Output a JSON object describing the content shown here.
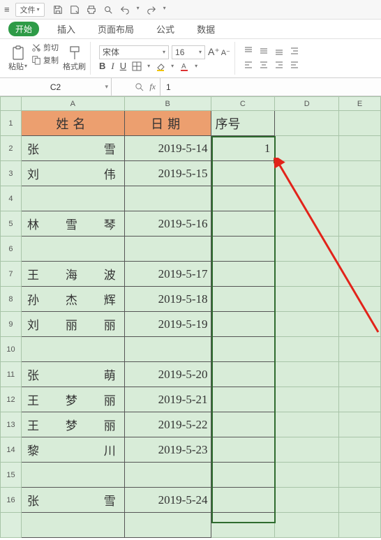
{
  "titlebar": {
    "file": "文件"
  },
  "tabs": {
    "start": "开始",
    "insert": "插入",
    "layout": "页面布局",
    "formula": "公式",
    "data": "数据"
  },
  "ribbon": {
    "paste": "粘贴",
    "cut": "剪切",
    "copy": "复制",
    "format_painter": "格式刷",
    "font_name": "宋体",
    "font_size": "16"
  },
  "namebox": "C2",
  "formula_value": "1",
  "columns": {
    "A": "A",
    "B": "B",
    "C": "C",
    "D": "D",
    "E": "E"
  },
  "header": {
    "name": "姓名",
    "date": "日期",
    "seq": "序号"
  },
  "seq_value": "1",
  "rows": {
    "2": {
      "name_chars": [
        "张",
        "",
        "雪"
      ],
      "date": "2019-5-14"
    },
    "3": {
      "name_chars": [
        "刘",
        "",
        "伟"
      ],
      "date": "2019-5-15"
    },
    "4": {
      "name_chars": [
        "",
        "",
        ""
      ],
      "date": ""
    },
    "5": {
      "name_chars": [
        "林",
        "雪",
        "琴"
      ],
      "date": "2019-5-16"
    },
    "6": {
      "name_chars": [
        "",
        "",
        ""
      ],
      "date": ""
    },
    "7": {
      "name_chars": [
        "王",
        "海",
        "波"
      ],
      "date": "2019-5-17"
    },
    "8": {
      "name_chars": [
        "孙",
        "杰",
        "辉"
      ],
      "date": "2019-5-18"
    },
    "9": {
      "name_chars": [
        "刘",
        "丽",
        "丽"
      ],
      "date": "2019-5-19"
    },
    "10": {
      "name_chars": [
        "",
        "",
        ""
      ],
      "date": ""
    },
    "11": {
      "name_chars": [
        "张",
        "",
        "萌"
      ],
      "date": "2019-5-20"
    },
    "12": {
      "name_chars": [
        "王",
        "梦",
        "丽"
      ],
      "date": "2019-5-21"
    },
    "13": {
      "name_chars": [
        "王",
        "梦",
        "丽"
      ],
      "date": "2019-5-22"
    },
    "14": {
      "name_chars": [
        "黎",
        "",
        "川"
      ],
      "date": "2019-5-23"
    },
    "15": {
      "name_chars": [
        "",
        "",
        ""
      ],
      "date": ""
    },
    "16": {
      "name_chars": [
        "张",
        "",
        "雪"
      ],
      "date": "2019-5-24"
    }
  }
}
